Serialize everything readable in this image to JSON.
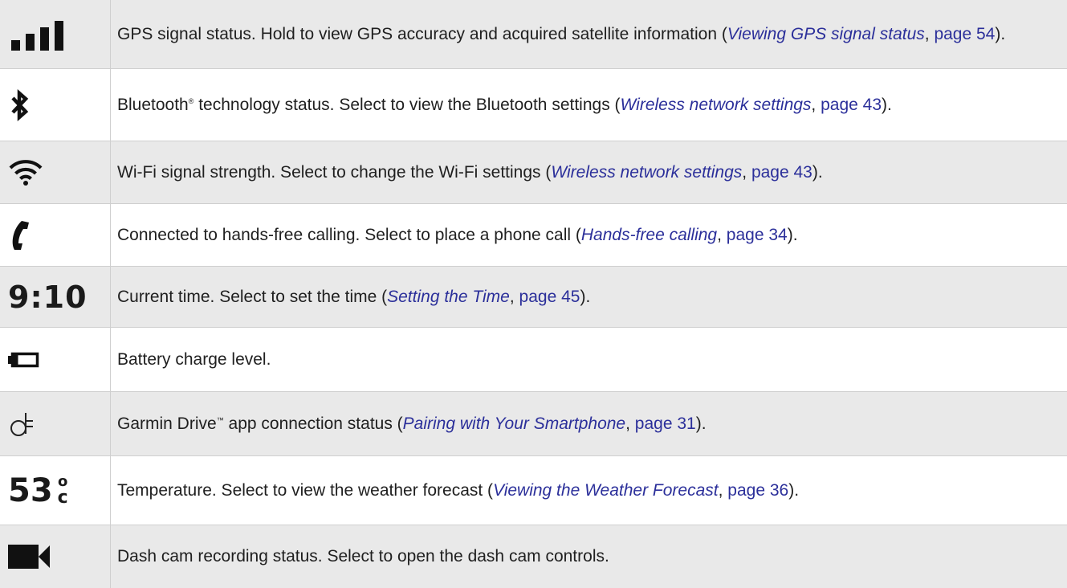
{
  "rows": [
    {
      "icon": "gps-signal-icon",
      "text1": "GPS signal status. Hold to view GPS accuracy and acquired satellite information (",
      "ref": "Viewing GPS signal status",
      "sep": ", ",
      "page": "page 54",
      "end": ")."
    },
    {
      "icon": "bluetooth-icon",
      "text1": "Bluetooth",
      "sup": "®",
      "text2": " technology status. Select to view the Bluetooth settings (",
      "ref": "Wireless network settings",
      "sep": ", ",
      "page": "page 43",
      "end": ")."
    },
    {
      "icon": "wifi-icon",
      "text1": "Wi-Fi signal strength. Select to change the Wi-Fi settings (",
      "ref": "Wireless network settings",
      "sep": ", ",
      "page": "page 43",
      "end": ")."
    },
    {
      "icon": "phone-icon",
      "text1": "Connected to hands-free calling. Select to place a phone call (",
      "ref": "Hands-free calling",
      "sep": ", ",
      "page": "page 34",
      "end": ")."
    },
    {
      "icon": "clock-text",
      "icon_text": "9:10",
      "text1": "Current time. Select to set the time (",
      "ref": "Setting the Time",
      "sep": ", ",
      "page": "page 45",
      "end": ")."
    },
    {
      "icon": "battery-icon",
      "text1": "Battery charge level."
    },
    {
      "icon": "garmin-drive-icon",
      "text1": "Garmin Drive",
      "sup": "™",
      "text2": " app connection status (",
      "ref": "Pairing with Your Smartphone",
      "sep": ", ",
      "page": "page 31",
      "end": ")."
    },
    {
      "icon": "temperature-text",
      "icon_text": "53",
      "icon_deg": "o",
      "icon_unit": "c",
      "text1": "Temperature. Select to view the weather forecast (",
      "ref": "Viewing the Weather Forecast",
      "sep": ", ",
      "page": "page 36",
      "end": ")."
    },
    {
      "icon": "dash-cam-icon",
      "text1": "Dash cam recording status. Select to open the dash cam controls."
    }
  ]
}
